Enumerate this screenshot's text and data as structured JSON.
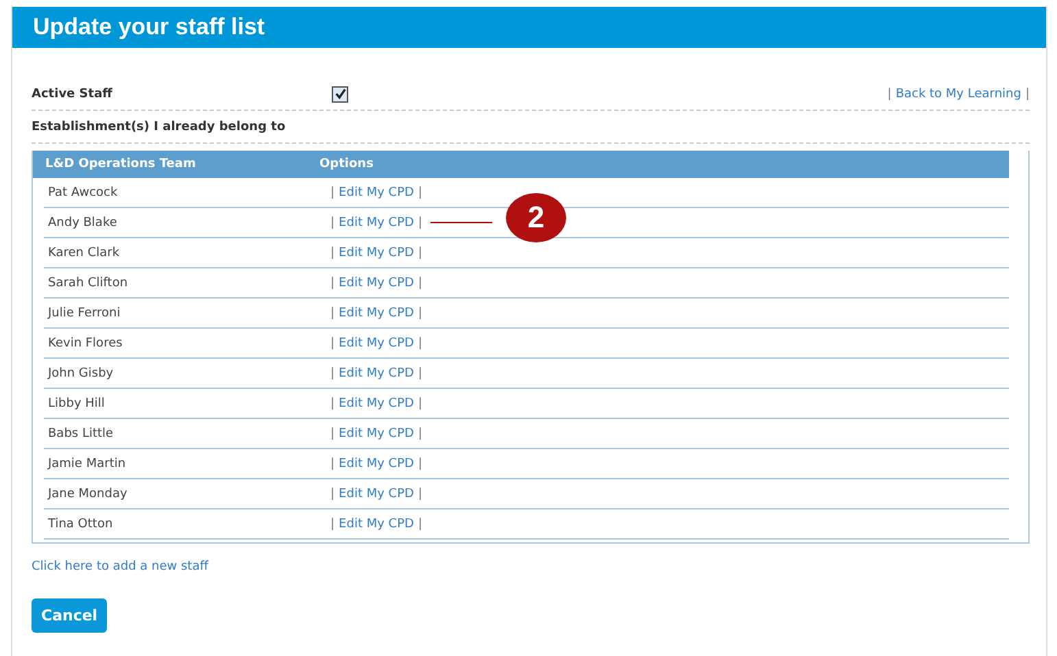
{
  "window": {
    "title": "Update your staff list"
  },
  "active_staff": {
    "label": "Active Staff",
    "checked": true
  },
  "back_link": {
    "left": "|",
    "label": "Back to My Learning",
    "right": "|"
  },
  "establishments_label": "Establishment(s) I already belong to",
  "table": {
    "columns": [
      "L&D Operations Team",
      "Options"
    ],
    "rows": [
      {
        "name": "Pat Awcock",
        "left": "|",
        "option": "Edit My CPD",
        "right": "|"
      },
      {
        "name": "Andy Blake",
        "left": "|",
        "option": "Edit My CPD",
        "right": "|",
        "callout": "2"
      },
      {
        "name": "Karen Clark",
        "left": "|",
        "option": "Edit My CPD",
        "right": "|"
      },
      {
        "name": "Sarah Clifton",
        "left": "|",
        "option": "Edit My CPD",
        "right": "|"
      },
      {
        "name": "Julie Ferroni",
        "left": "|",
        "option": "Edit My CPD",
        "right": "|"
      },
      {
        "name": "Kevin Flores",
        "left": "|",
        "option": "Edit My CPD",
        "right": "|"
      },
      {
        "name": "John Gisby",
        "left": "|",
        "option": "Edit My CPD",
        "right": "|"
      },
      {
        "name": "Libby Hill",
        "left": "|",
        "option": "Edit My CPD",
        "right": "|"
      },
      {
        "name": "Babs Little",
        "left": "|",
        "option": "Edit My CPD",
        "right": "|"
      },
      {
        "name": "Jamie Martin",
        "left": "|",
        "option": "Edit My CPD",
        "right": "|"
      },
      {
        "name": "Jane Monday",
        "left": "|",
        "option": "Edit My CPD",
        "right": "|"
      },
      {
        "name": "Tina Otton",
        "left": "|",
        "option": "Edit My CPD",
        "right": "|"
      }
    ]
  },
  "add_link": "Click here to add a new staff",
  "buttons": [
    "Cancel"
  ]
}
